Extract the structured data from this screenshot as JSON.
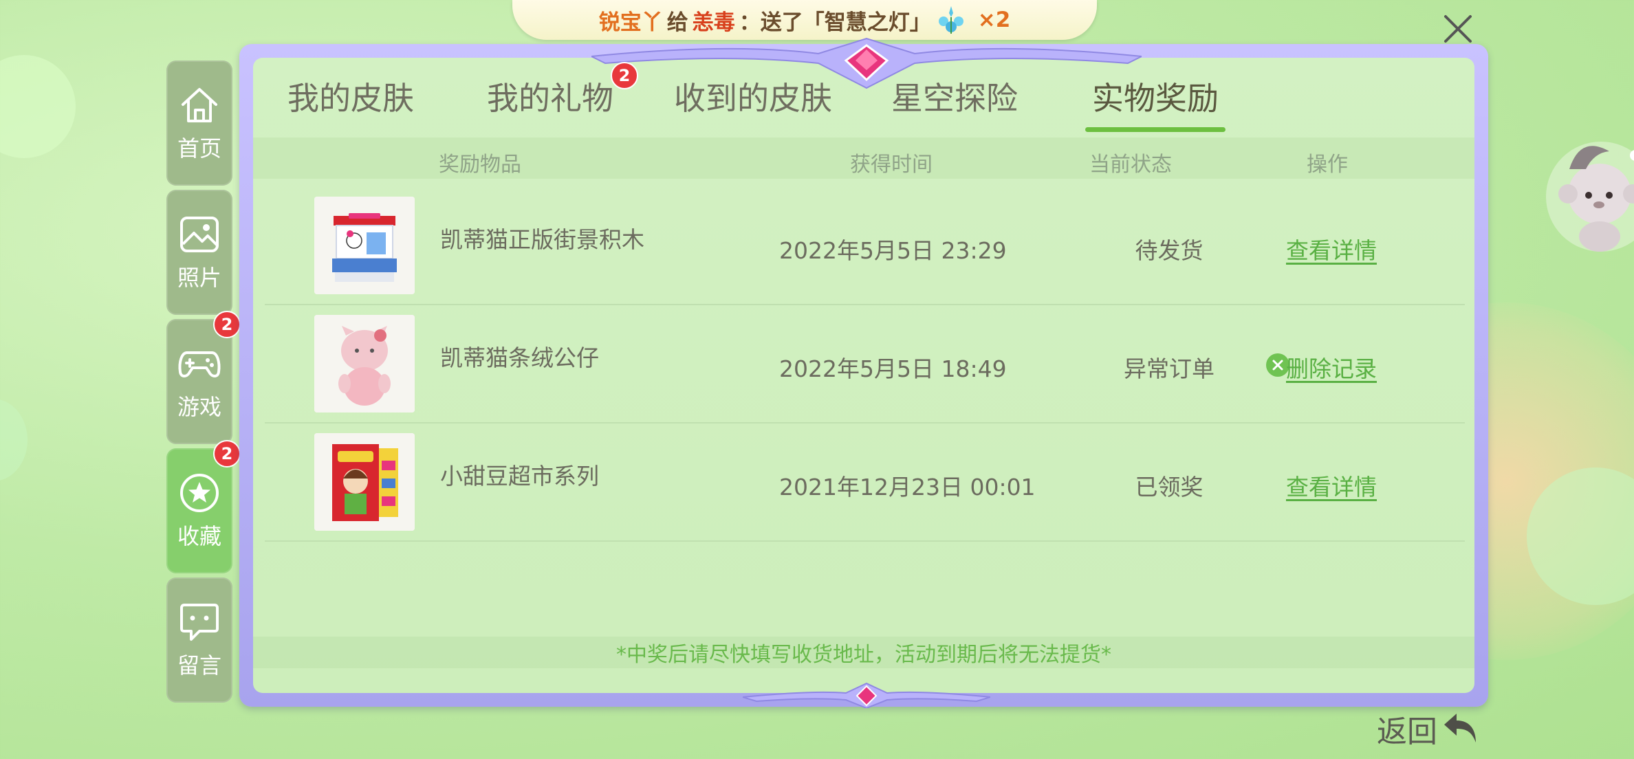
{
  "banner": {
    "sender": "锐宝丫",
    "verb": "给",
    "receiver": "恙毒",
    "message": "：送了「智慧之灯」",
    "count": "×2",
    "gift_icon": "gem-flower-icon"
  },
  "sidebar": {
    "items": [
      {
        "label": "首页",
        "icon": "home-icon",
        "badge": ""
      },
      {
        "label": "照片",
        "icon": "photo-icon",
        "badge": ""
      },
      {
        "label": "游戏",
        "icon": "gamepad-icon",
        "badge": "2"
      },
      {
        "label": "收藏",
        "icon": "star-icon",
        "badge": "2"
      },
      {
        "label": "留言",
        "icon": "message-icon",
        "badge": ""
      }
    ]
  },
  "tabs": [
    {
      "label": "我的皮肤",
      "badge": ""
    },
    {
      "label": "我的礼物",
      "badge": "2"
    },
    {
      "label": "收到的皮肤",
      "badge": ""
    },
    {
      "label": "星空探险",
      "badge": ""
    },
    {
      "label": "实物奖励",
      "badge": "",
      "active": true
    }
  ],
  "table": {
    "headers": {
      "item": "奖励物品",
      "time": "获得时间",
      "status": "当前状态",
      "action": "操作"
    },
    "rows": [
      {
        "name": "凯蒂猫正版街景积木",
        "time": "2022年5月5日 23:29",
        "status": "待发货",
        "action": "查看详情",
        "action_type": "view"
      },
      {
        "name": "凯蒂猫条绒公仔",
        "time": "2022年5月5日 18:49",
        "status": "异常订单",
        "action": "删除记录",
        "action_type": "delete"
      },
      {
        "name": "小甜豆超市系列",
        "time": "2021年12月23日 00:01",
        "status": "已领奖",
        "action": "查看详情",
        "action_type": "view"
      }
    ]
  },
  "footnote": "*中奖后请尽快填写收货地址，活动到期后将无法提货*",
  "back_label": "返回",
  "colors": {
    "accent_green": "#6cbf3f",
    "badge_red": "#e8383c",
    "frame_purple": "#a8a3ee"
  }
}
